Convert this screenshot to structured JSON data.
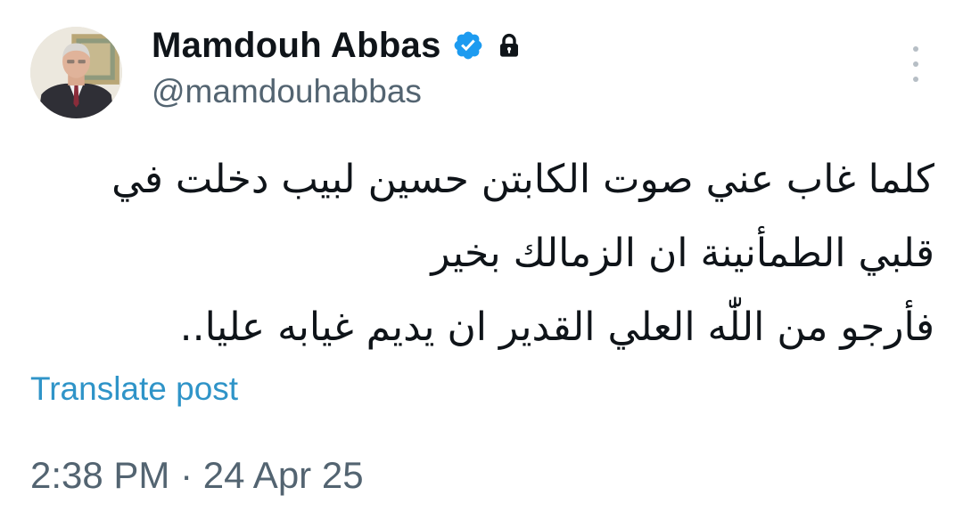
{
  "author": {
    "display_name": "Mamdouh Abbas",
    "handle": "@mamdouhabbas",
    "avatar_icon": "profile-photo",
    "verified_icon": "verified-badge-icon",
    "verified_color": "#1d9bf0",
    "protected_icon": "lock-icon"
  },
  "post": {
    "lines": [
      "كلما غاب عني صوت الكابتن حسين لبيب دخلت في",
      "قلبي الطمأنينة ان الزمالك بخير",
      "فأرجو من اللّٰه العلي القدير  ان يديم غيابه عليا.."
    ],
    "translate_label": "Translate post",
    "translate_color": "#2f94c8",
    "timestamp": "2:38 PM · 24 Apr 25"
  },
  "menu": {
    "icon": "more-vertical-icon"
  }
}
